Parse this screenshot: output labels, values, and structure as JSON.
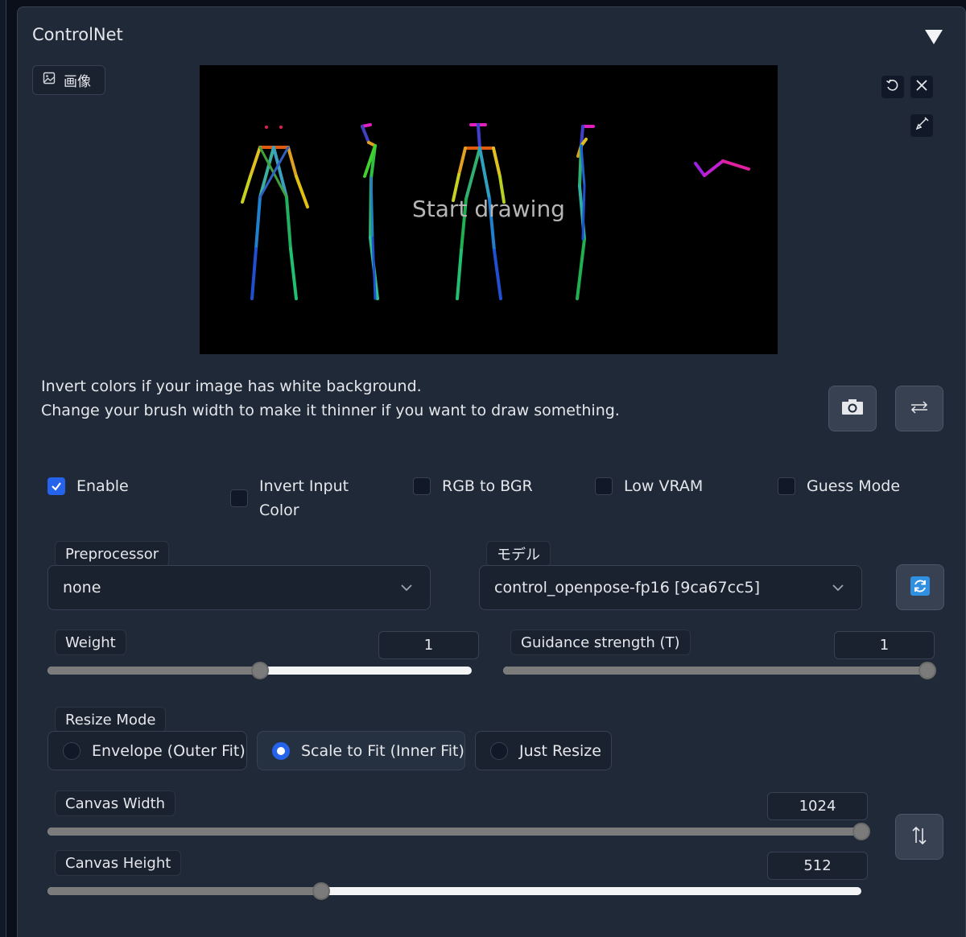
{
  "panel": {
    "title": "ControlNet"
  },
  "image_tab": {
    "label": "画像"
  },
  "canvas": {
    "overlay_text": "Start drawing",
    "background": "#000000"
  },
  "info": {
    "line1": "Invert colors if your image has white background.",
    "line2": "Change your brush width to make it thinner if you want to draw something."
  },
  "checkboxes": [
    {
      "label": "Enable",
      "checked": true
    },
    {
      "label_line1": "Invert Input",
      "label_line2": "Color",
      "checked": false
    },
    {
      "label": "RGB to BGR",
      "checked": false
    },
    {
      "label": "Low VRAM",
      "checked": false
    },
    {
      "label": "Guess Mode",
      "checked": false
    }
  ],
  "preprocessor": {
    "label": "Preprocessor",
    "value": "none"
  },
  "model": {
    "label": "モデル",
    "value": "control_openpose-fp16 [9ca67cc5]"
  },
  "weight": {
    "label": "Weight",
    "value": "1",
    "fraction": 0.5
  },
  "guidance": {
    "label": "Guidance strength (T)",
    "value": "1",
    "fraction": 1.0
  },
  "resize_mode": {
    "label": "Resize Mode",
    "options": [
      "Envelope (Outer Fit)",
      "Scale to Fit (Inner Fit)",
      "Just Resize"
    ],
    "selected": "Scale to Fit (Inner Fit)"
  },
  "canvas_width": {
    "label": "Canvas Width",
    "value": "1024"
  },
  "canvas_height": {
    "label": "Canvas Height",
    "value": "512"
  },
  "colors": {
    "accent": "#2563eb",
    "panel_bg": "#1f2937",
    "page_bg": "#0b0f19"
  },
  "icons": [
    "image-icon",
    "undo-icon",
    "close-icon",
    "brush-icon",
    "camera-icon",
    "swap-icon",
    "refresh-icon",
    "swap-vertical-icon",
    "chevron-down-icon",
    "collapse-icon"
  ]
}
